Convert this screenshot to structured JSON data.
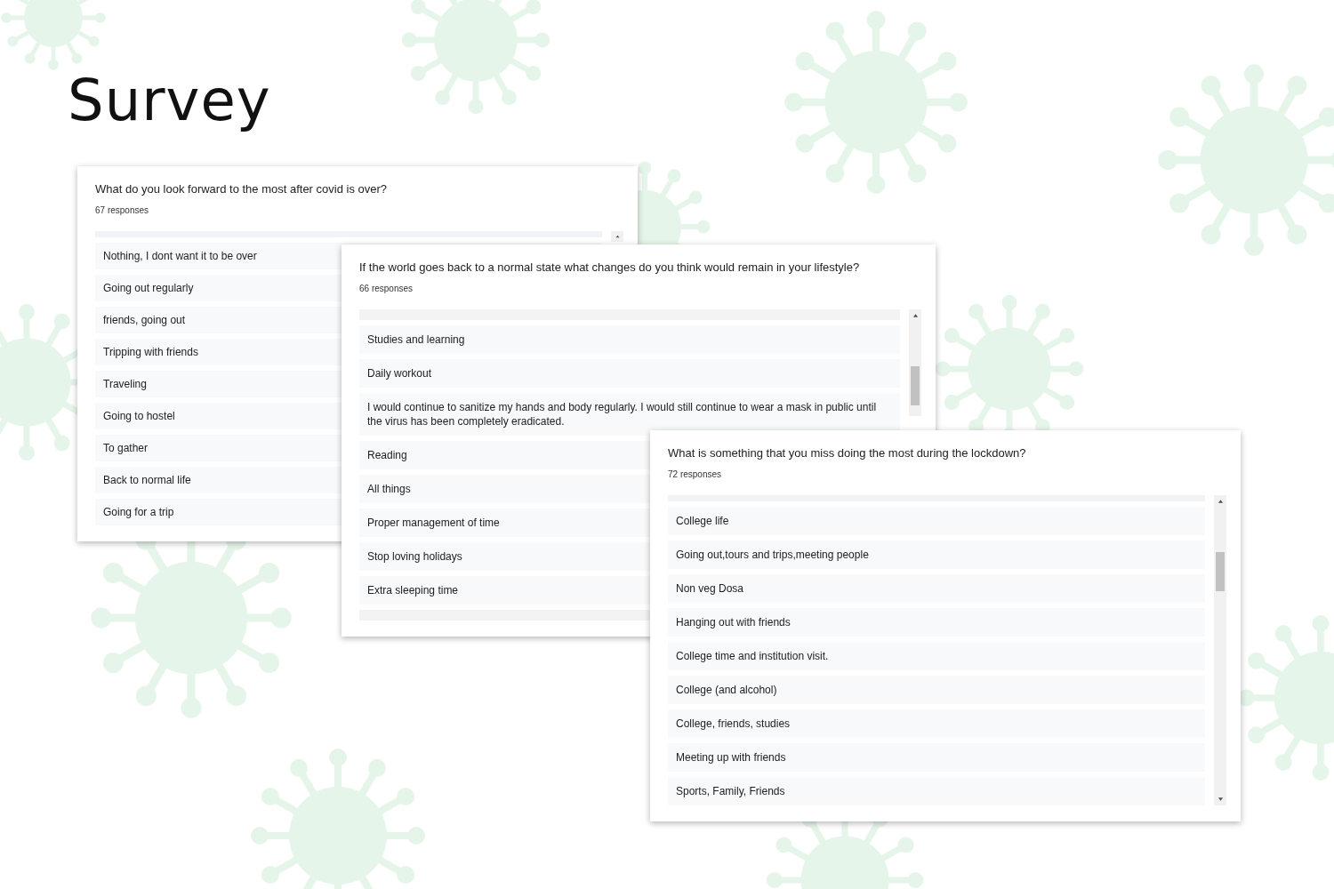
{
  "title": "Survey",
  "cards": [
    {
      "question": "What do you look forward to the most after covid is over?",
      "responses": "67 responses",
      "answers": [
        "Nothing, I dont want it to be over",
        "Going out regularly",
        "friends, going out",
        "Tripping with friends",
        "Traveling",
        "Going to hostel",
        "To gather",
        "Back to normal life",
        "Going for a trip"
      ]
    },
    {
      "question": "If the world goes back to a normal state what changes do you think would remain in your lifestyle?",
      "responses": "66 responses",
      "answers": [
        "Studies and learning",
        "Daily workout",
        "I would continue to sanitize my hands and body regularly. I would still continue to wear a mask in public until the virus has been completely eradicated.",
        "Reading",
        "All things",
        "Proper management of time",
        "Stop loving holidays",
        "Extra sleeping time"
      ]
    },
    {
      "question": "What is something that you miss doing the most during the lockdown?",
      "responses": "72 responses",
      "answers": [
        "College life",
        "Going out,tours and trips,meeting people",
        "Non veg Dosa",
        "Hanging out with friends",
        "College time and institution visit.",
        "College (and alcohol)",
        "College, friends, studies",
        "Meeting up with friends",
        "Sports, Family, Friends"
      ]
    }
  ]
}
